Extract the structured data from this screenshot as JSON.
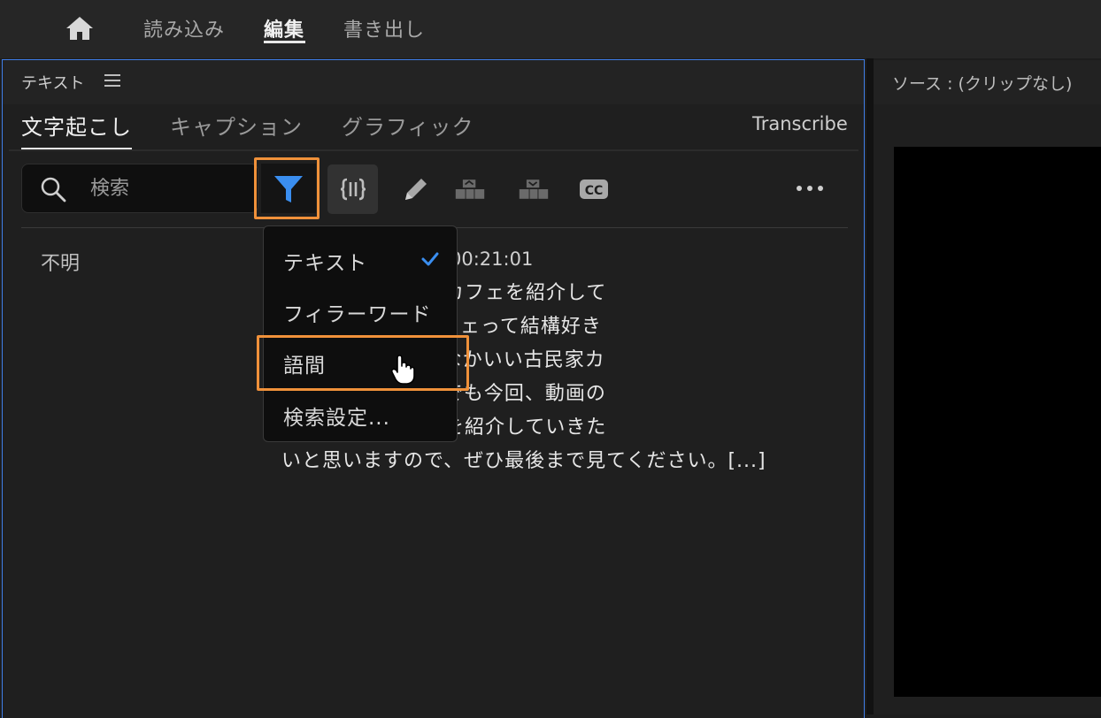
{
  "nav": {
    "tabs": [
      {
        "label": "読み込み"
      },
      {
        "label": "編集"
      },
      {
        "label": "書き出し"
      }
    ],
    "active_tab": "編集"
  },
  "panel": {
    "title": "テキスト",
    "tabs": [
      {
        "label": "文字起こし"
      },
      {
        "label": "キャプション"
      },
      {
        "label": "グラフィック"
      }
    ],
    "transcribe_label": "Transcribe"
  },
  "search": {
    "placeholder": "検索"
  },
  "filter_menu": {
    "items": [
      {
        "label": "テキスト",
        "checked": true
      },
      {
        "label": "フィラーワード",
        "checked": false
      },
      {
        "label": "語間",
        "checked": false
      },
      {
        "label": "検索設定..."
      }
    ]
  },
  "transcript": {
    "speaker": "不明",
    "timecode": "00:21:01",
    "lines": [
      "周辺のオシャレなカフェを紹介して",
      "す。[...]古民家カフェって結構好き",
      "んですけど、なかなかいい古民家カ",
      "くいんですよね。でも今回、動画の",
      "いろいろなカフェを紹介していきた",
      "いと思いますので、ぜひ最後まで見てください。[...]"
    ]
  },
  "source_panel": {
    "title": "ソース : (クリップなし)"
  },
  "colors": {
    "accent_blue": "#3f7ee8",
    "highlight_orange": "#f0913a"
  },
  "icons": [
    "home-icon",
    "hamburger-icon",
    "search-icon",
    "filter-icon",
    "pause-marker-icon",
    "pencil-icon",
    "speaker-merge-icon",
    "speaker-split-icon",
    "cc-icon",
    "more-icon",
    "check-icon",
    "pointer-hand-icon"
  ]
}
